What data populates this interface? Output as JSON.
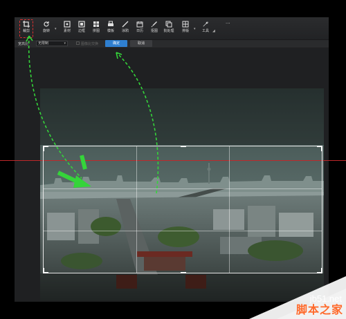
{
  "toolbar": {
    "tools": [
      {
        "name": "crop",
        "label": "裁剪",
        "icon": "crop-icon"
      },
      {
        "name": "rotate",
        "label": "旋转",
        "icon": "rotate-icon"
      },
      {
        "name": "material",
        "label": "素材",
        "icon": "sticker-icon"
      },
      {
        "name": "border",
        "label": "边框",
        "icon": "frame-icon"
      },
      {
        "name": "collage",
        "label": "拼图",
        "icon": "collage-icon"
      },
      {
        "name": "template",
        "label": "模板",
        "icon": "printer-icon"
      },
      {
        "name": "doodle",
        "label": "涂鸦",
        "icon": "brush-icon"
      },
      {
        "name": "calendar",
        "label": "日历",
        "icon": "calendar-icon"
      },
      {
        "name": "matting",
        "label": "抠图",
        "icon": "pen-icon"
      },
      {
        "name": "batch",
        "label": "批处理",
        "icon": "batch-icon"
      },
      {
        "name": "layout",
        "label": "排版",
        "icon": "layout-icon"
      },
      {
        "name": "tools",
        "label": "工具",
        "icon": "wrench-icon"
      }
    ],
    "more_label": "···"
  },
  "options": {
    "ratio_label": "宽高比",
    "ratio_value": "无限制",
    "lock_label": "图像比交换",
    "confirm_label": "确定",
    "cancel_label": "取消"
  },
  "watermark": {
    "url": "jb51.net",
    "site_name": "脚本之家"
  },
  "colors": {
    "accent": "#2f7fd0",
    "arrow": "#35d43a",
    "guide": "#c0282a",
    "highlight": "#e03030"
  }
}
